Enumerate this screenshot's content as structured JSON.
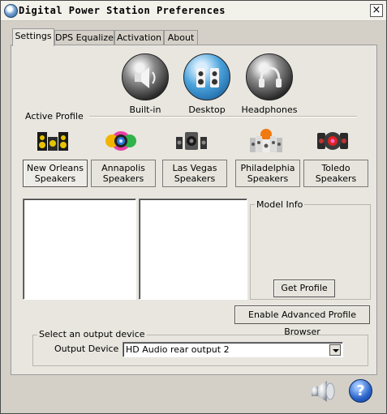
{
  "window": {
    "title": "Digital Power Station Preferences",
    "close_glyph": "×"
  },
  "tabs": [
    {
      "label": "Settings",
      "active": true
    },
    {
      "label": "DPS Equalizer",
      "active": false
    },
    {
      "label": "Activation",
      "active": false
    },
    {
      "label": "About",
      "active": false
    }
  ],
  "modes": [
    {
      "label": "Built-in",
      "icon": "speaker-icon"
    },
    {
      "label": "Desktop",
      "icon": "desktop-speakers-icon"
    },
    {
      "label": "Headphones",
      "icon": "headphones-icon"
    }
  ],
  "active_profile": {
    "label": "Active Profile",
    "profiles": [
      {
        "label": "New Orleans Speakers",
        "line1": "New Orleans",
        "line2": "Speakers",
        "icon": "new-orleans-speakers-icon",
        "selected": true
      },
      {
        "label": "Annapolis Speakers",
        "line1": "Annapolis",
        "line2": "Speakers",
        "icon": "annapolis-speakers-icon",
        "selected": false
      },
      {
        "label": "Las Vegas Speakers",
        "line1": "Las Vegas",
        "line2": "Speakers",
        "icon": "las-vegas-speakers-icon",
        "selected": false
      },
      {
        "label": "Philadelphia Speakers",
        "line1": "Philadelphia",
        "line2": "Speakers",
        "icon": "philadelphia-speakers-icon",
        "selected": false
      },
      {
        "label": "Toledo Speakers",
        "line1": "Toledo",
        "line2": "Speakers",
        "icon": "toledo-speakers-icon",
        "selected": false
      }
    ]
  },
  "model_info": {
    "label": "Model Info",
    "get_profile": "Get Profile"
  },
  "enable_advanced": "Enable Advanced Profile Browser",
  "output": {
    "group_label": "Select an output device",
    "field_label": "Output Device",
    "selected": "HD Audio rear output 2"
  },
  "footer": {
    "speaker_icon": "speaker-icon",
    "help_icon": "help-icon",
    "help_glyph": "?"
  },
  "colors": {
    "accent_blue": "#1e5fb4",
    "help_blue": "#2a62c8"
  }
}
